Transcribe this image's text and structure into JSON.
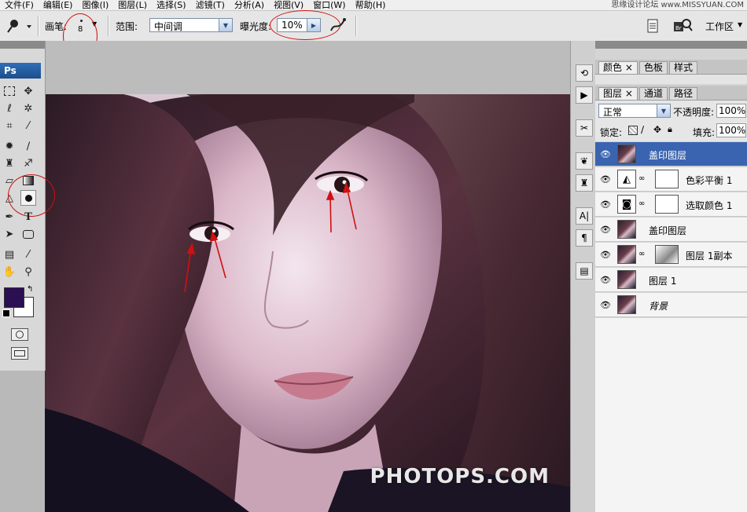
{
  "menu": {
    "items": [
      "文件(F)",
      "编辑(E)",
      "图像(I)",
      "图层(L)",
      "选择(S)",
      "滤镜(T)",
      "分析(A)",
      "视图(V)",
      "窗口(W)",
      "帮助(H)"
    ],
    "watermark": "思缘设计论坛 www.MISSYUAN.COM"
  },
  "options": {
    "brush_label": "画笔:",
    "brush_size": "8",
    "range_label": "范围:",
    "range_value": "中间调",
    "exposure_label": "曝光度:",
    "exposure_value": "10%",
    "workspace_label": "工作区"
  },
  "toolbox": {
    "logo": "Ps",
    "type_tool": "T"
  },
  "panels": {
    "color_tabs": [
      "颜色",
      "色板",
      "样式"
    ],
    "layer_tabs": [
      "图层",
      "通道",
      "路径"
    ],
    "blend_mode": "正常",
    "opacity_label": "不透明度:",
    "opacity_value": "100%",
    "lock_label": "锁定:",
    "fill_label": "填充:",
    "fill_value": "100%",
    "layers": [
      {
        "name": "盖印图层",
        "selected": true
      },
      {
        "name": "色彩平衡 1"
      },
      {
        "name": "选取颜色 1"
      },
      {
        "name": "盖印图层"
      },
      {
        "name": "图层 1副本"
      },
      {
        "name": "图层 1"
      },
      {
        "name": "背景"
      }
    ]
  },
  "canvas": {
    "watermark": "PHOTOPS.COM"
  },
  "colors": {
    "foreground": "#2a0f52",
    "background": "#ffffff",
    "annotation": "#d01010",
    "selected_layer": "#3a64b0"
  }
}
